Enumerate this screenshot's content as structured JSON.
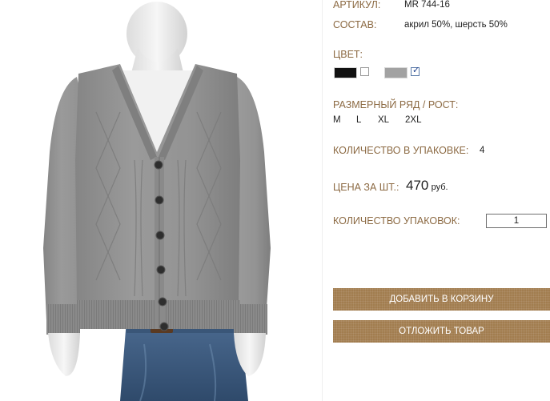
{
  "product": {
    "article_label": "АРТИКУЛ:",
    "article_value": "MR 744-16",
    "composition_label": "СОСТАВ:",
    "composition_value": "акрил 50%, шерсть 50%",
    "color_label": "ЦВЕТ:",
    "colors": [
      {
        "name": "black",
        "hex": "#111111",
        "selected": false
      },
      {
        "name": "grey",
        "hex": "#a2a2a2",
        "selected": true
      }
    ],
    "size_label": "РАЗМЕРНЫЙ РЯД / РОСТ:",
    "sizes": [
      "M",
      "L",
      "XL",
      "2XL"
    ],
    "pack_qty_label": "КОЛИЧЕСТВО В УПАКОВКЕ:",
    "pack_qty_value": "4",
    "price_label": "ЦЕНА ЗА ШТ.:",
    "price_value": "470",
    "price_unit": "руб.",
    "packs_label": "КОЛИЧЕСТВО УПАКОВОК:",
    "packs_value": "1"
  },
  "buttons": {
    "add_to_cart": "ДОБАВИТЬ В КОРЗИНУ",
    "defer": "ОТЛОЖИТЬ ТОВАР"
  },
  "colors_ui": {
    "accent_label": "#8c6a43",
    "button_bg": "#a27d4f",
    "sweater": "#8f8f8f",
    "jeans": "#3f5f86"
  }
}
